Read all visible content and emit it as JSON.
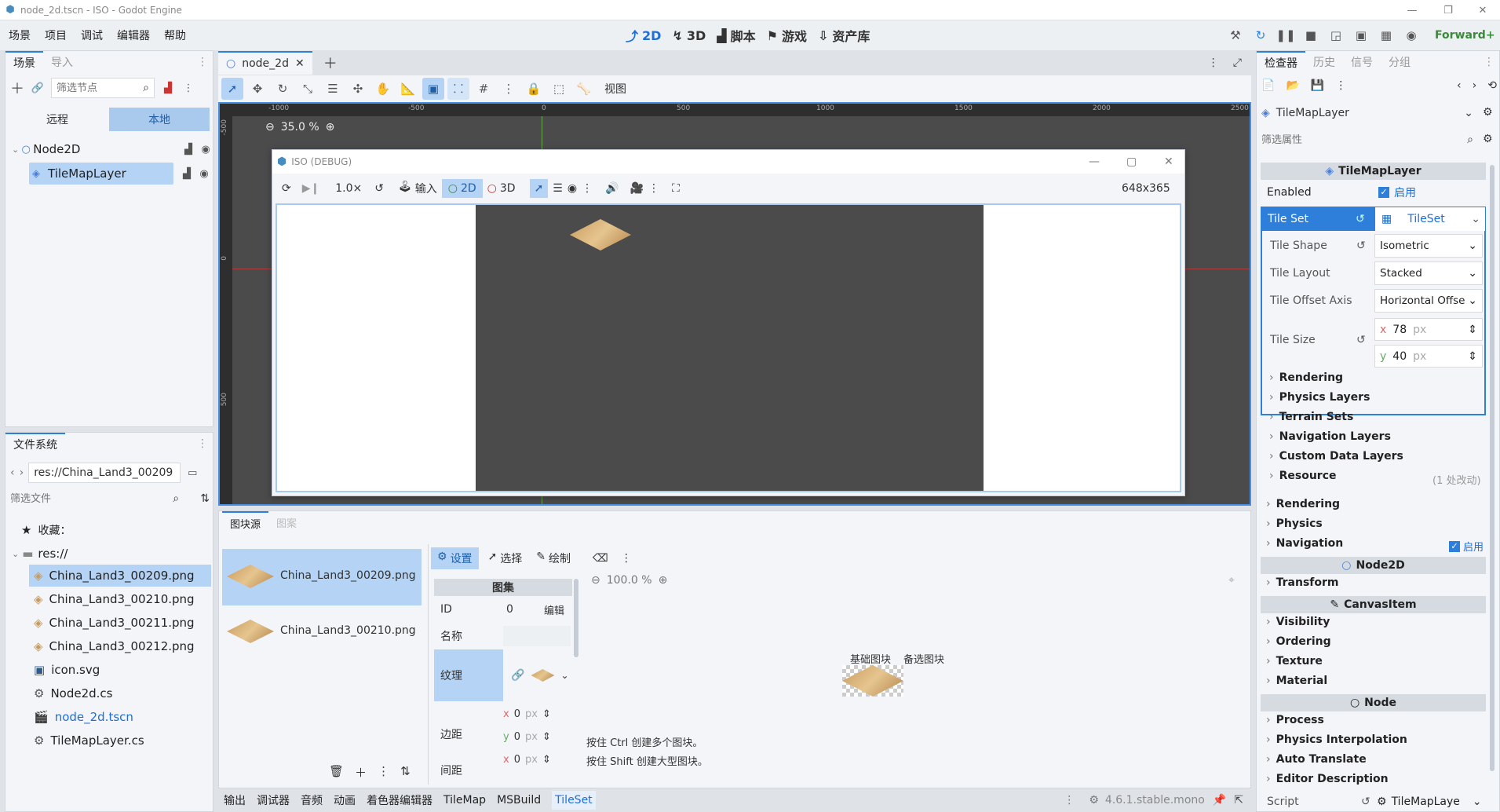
{
  "window": {
    "title": "node_2d.tscn - ISO - Godot Engine"
  },
  "menu": [
    "场景",
    "项目",
    "调试",
    "编辑器",
    "帮助"
  ],
  "workspaces": [
    {
      "label": "2D",
      "icon": "2d-icon",
      "active": true
    },
    {
      "label": "3D",
      "icon": "3d-icon",
      "active": false
    },
    {
      "label": "脚本",
      "icon": "script-icon",
      "active": false
    },
    {
      "label": "游戏",
      "icon": "game-icon",
      "active": false
    },
    {
      "label": "资产库",
      "icon": "asset-library-icon",
      "active": false
    }
  ],
  "renderer": "Forward+",
  "scene_dock": {
    "tabs": [
      "场景",
      "导入"
    ],
    "filter_placeholder": "筛选节点",
    "remote": "远程",
    "local": "本地",
    "nodes": [
      {
        "name": "Node2D"
      },
      {
        "name": "TileMapLayer"
      }
    ]
  },
  "filesystem": {
    "title": "文件系统",
    "path": "res://China_Land3_00209",
    "filter_placeholder": "筛选文件",
    "favorites": "收藏：",
    "root": "res://",
    "files": [
      {
        "name": "China_Land3_00209.png",
        "icon": "tile-icon"
      },
      {
        "name": "China_Land3_00210.png",
        "icon": "tile-icon"
      },
      {
        "name": "China_Land3_00211.png",
        "icon": "tile-icon"
      },
      {
        "name": "China_Land3_00212.png",
        "icon": "tile-icon"
      },
      {
        "name": "icon.svg",
        "icon": "image-icon"
      },
      {
        "name": "Node2d.cs",
        "icon": "csharp-icon"
      },
      {
        "name": "node_2d.tscn",
        "icon": "scene-icon"
      },
      {
        "name": "TileMapLayer.cs",
        "icon": "csharp-icon"
      }
    ]
  },
  "editor": {
    "tab": "node_2d",
    "view_menu": "视图",
    "zoom": "35.0 %",
    "ruler_top": [
      "-1000",
      "-500",
      "0",
      "500",
      "1000",
      "1500",
      "2000",
      "2500"
    ],
    "ruler_left": [
      "-500",
      "0",
      "500"
    ]
  },
  "game_window": {
    "title": "ISO (DEBUG)",
    "speed": "1.0×",
    "input": "输入",
    "mode2d": "2D",
    "mode3d": "3D",
    "size": "648x365"
  },
  "tileset_panel": {
    "tabs": [
      "图块源",
      "图案"
    ],
    "sources": [
      "China_Land3_00209.png",
      "China_Land3_00210.png"
    ],
    "modes": [
      "设置",
      "选择",
      "绘制"
    ],
    "atlas_header": "图集",
    "id_label": "ID",
    "id_value": "0",
    "edit": "编辑",
    "name_label": "名称",
    "texture_label": "纹理",
    "margin_label": "边距",
    "margin_x": "0",
    "margin_y": "0",
    "sep_x": "0",
    "unit": "px",
    "cut_label": "间距",
    "zoom": "100.0 %",
    "base_tile": "基础图块",
    "alt_tile": "备选图块",
    "hint1": "按住 Ctrl 创建多个图块。",
    "hint2": "按住 Shift 创建大型图块。"
  },
  "bottom_tabs": [
    "输出",
    "调试器",
    "音频",
    "动画",
    "着色器编辑器",
    "TileMap",
    "MSBuild",
    "TileSet"
  ],
  "version": "4.6.1.stable.mono",
  "inspector": {
    "tabs": [
      "检查器",
      "历史",
      "信号",
      "分组"
    ],
    "object": "TileMapLayer",
    "filter_placeholder": "筛选属性",
    "class_header": "TileMapLayer",
    "enabled_label": "Enabled",
    "enabled_value": "启用",
    "tileset_label": "Tile Set",
    "tileset_value": "TileSet",
    "props": [
      {
        "label": "Tile Shape",
        "value": "Isometric"
      },
      {
        "label": "Tile Layout",
        "value": "Stacked"
      },
      {
        "label": "Tile Offset Axis",
        "value": "Horizontal Offse"
      }
    ],
    "tile_size_label": "Tile Size",
    "tile_size_x": "78",
    "tile_size_y": "40",
    "unit": "px",
    "sub_groups": [
      "Rendering",
      "Physics Layers",
      "Terrain Sets",
      "Navigation Layers",
      "Custom Data Layers",
      "Resource"
    ],
    "resource_changes": "(1 处改动)",
    "groups1": [
      "Rendering",
      "Physics",
      "Navigation"
    ],
    "nav_enabled": "启用",
    "node2d_header": "Node2D",
    "groups2": [
      "Transform"
    ],
    "canvasitem_header": "CanvasItem",
    "groups3": [
      "Visibility",
      "Ordering",
      "Texture",
      "Material"
    ],
    "node_header": "Node",
    "groups4": [
      "Process",
      "Physics Interpolation",
      "Auto Translate",
      "Editor Description"
    ],
    "script_label": "Script",
    "script_value": "TileMapLaye"
  }
}
